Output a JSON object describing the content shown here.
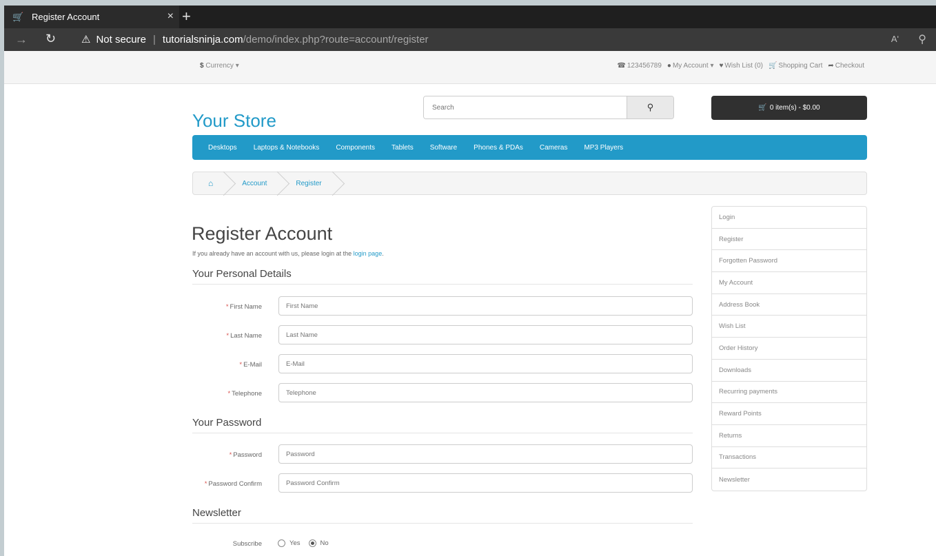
{
  "browser": {
    "tab_title": "Register Account",
    "tab_close": "×",
    "new_tab": "+",
    "not_secure": "Not secure",
    "url_host": "tutorialsninja.com",
    "url_path": "/demo/index.php?route=account/register",
    "read_aloud": "Aʹ",
    "icons": [
      "cart-favicon",
      "forward-icon",
      "reload-icon",
      "warning-icon",
      "read-aloud-icon",
      "zoom-icon",
      "close-icon",
      "plus-icon"
    ]
  },
  "topbar": {
    "currency_symbol": "$",
    "currency_label": "Currency",
    "phone": "123456789",
    "my_account": "My Account",
    "wish_list": "Wish List (0)",
    "shopping_cart": "Shopping Cart",
    "checkout": "Checkout"
  },
  "header": {
    "logo": "Your Store",
    "search_placeholder": "Search",
    "cart": "0 item(s) - $0.00"
  },
  "menu": [
    "Desktops",
    "Laptops & Notebooks",
    "Components",
    "Tablets",
    "Software",
    "Phones & PDAs",
    "Cameras",
    "MP3 Players"
  ],
  "breadcrumb": [
    "Account",
    "Register"
  ],
  "content": {
    "title": "Register Account",
    "intro_prefix": "If you already have an account with us, please login at the ",
    "intro_link": "login page",
    "intro_suffix": ".",
    "personal_legend": "Your Personal Details",
    "password_legend": "Your Password",
    "newsletter_legend": "Newsletter",
    "required_mark": "*",
    "fields": {
      "firstname": {
        "label": "First Name",
        "placeholder": "First Name"
      },
      "lastname": {
        "label": "Last Name",
        "placeholder": "Last Name"
      },
      "email": {
        "label": "E-Mail",
        "placeholder": "E-Mail"
      },
      "telephone": {
        "label": "Telephone",
        "placeholder": "Telephone"
      },
      "password": {
        "label": "Password",
        "placeholder": "Password"
      },
      "confirm": {
        "label": "Password Confirm",
        "placeholder": "Password Confirm"
      }
    },
    "subscribe": {
      "label": "Subscribe",
      "yes": "Yes",
      "no": "No",
      "selected": "No"
    }
  },
  "sidebar": [
    "Login",
    "Register",
    "Forgotten Password",
    "My Account",
    "Address Book",
    "Wish List",
    "Order History",
    "Downloads",
    "Recurring payments",
    "Reward Points",
    "Returns",
    "Transactions",
    "Newsletter"
  ],
  "colors": {
    "accent": "#229ac8",
    "required": "#d9534f",
    "dark_button": "#303030"
  }
}
